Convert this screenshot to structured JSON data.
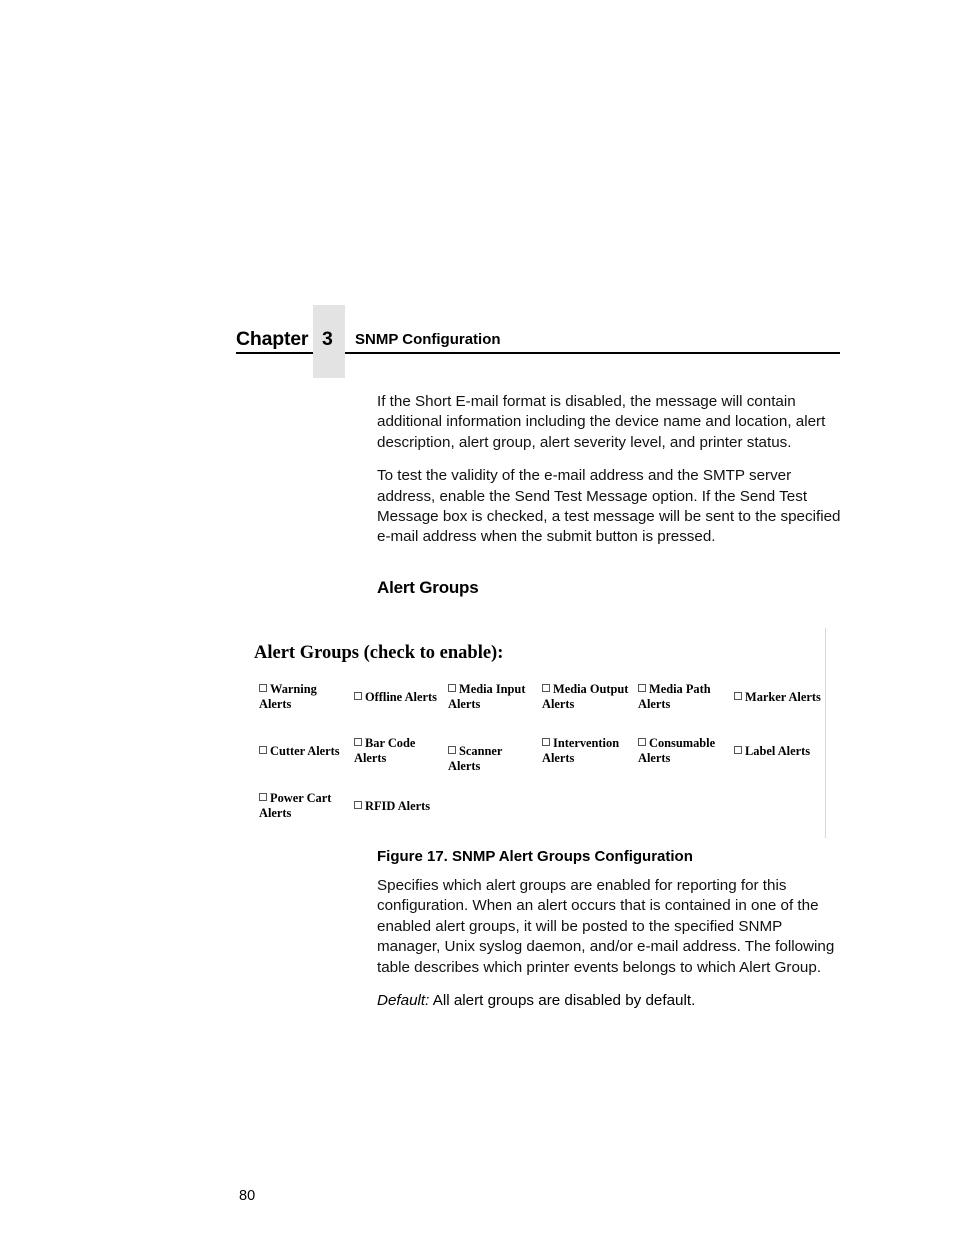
{
  "header": {
    "chapter_label": "Chapter",
    "chapter_number": "3",
    "chapter_subject": "SNMP Configuration"
  },
  "body": {
    "paragraph_1": "If the Short E-mail format is disabled, the message will contain additional information including the device name and location, alert description, alert group, alert severity level, and printer status.",
    "paragraph_2": "To test the validity of the e-mail address and the SMTP server address, enable the Send Test Message option. If the Send Test Message box is checked, a test message will be sent to the specified e-mail address when the submit button is pressed.",
    "section_heading": "Alert Groups",
    "paragraph_3": "Specifies which alert groups are enabled for reporting for this configuration. When an alert occurs that is contained in one of the enabled alert groups, it will be posted to the specified SNMP manager, Unix syslog daemon, and/or e-mail address.  The following table describes which printer events belongs to which Alert Group.",
    "default_label": "Default:",
    "default_text": " All alert groups are disabled by default."
  },
  "figure": {
    "caption": "Figure 17. SNMP Alert Groups Configuration",
    "screenshot": {
      "title": "Alert Groups (check to enable):",
      "rows": [
        [
          {
            "label": "Warning Alerts",
            "checked": false,
            "wrap": true
          },
          {
            "label": "Offline Alerts",
            "checked": false,
            "wrap": false
          },
          {
            "label": "Media Input Alerts",
            "checked": false,
            "wrap": true
          },
          {
            "label": "Media Output Alerts",
            "checked": false,
            "wrap": true
          },
          {
            "label": "Media Path Alerts",
            "checked": false,
            "wrap": true
          },
          {
            "label": "Marker Alerts",
            "checked": false,
            "wrap": false
          }
        ],
        [
          {
            "label": "Cutter Alerts",
            "checked": false,
            "wrap": false
          },
          {
            "label": "Bar Code Alerts",
            "checked": false,
            "wrap": true
          },
          {
            "label": "Scanner Alerts",
            "checked": false,
            "wrap": false
          },
          {
            "label": "Intervention Alerts",
            "checked": false,
            "wrap": true
          },
          {
            "label": "Consumable Alerts",
            "checked": false,
            "wrap": true
          },
          {
            "label": "Label Alerts",
            "checked": false,
            "wrap": false
          }
        ],
        [
          {
            "label": "Power Cart Alerts",
            "checked": false,
            "wrap": true
          },
          {
            "label": "RFID Alerts",
            "checked": false,
            "wrap": false
          }
        ]
      ]
    }
  },
  "footer": {
    "page_number": "80"
  },
  "colors": {
    "text": "#000000",
    "chapter_box": "#e3e3e3",
    "figure_border": "#d8d8d8",
    "page_background": "#ffffff"
  }
}
